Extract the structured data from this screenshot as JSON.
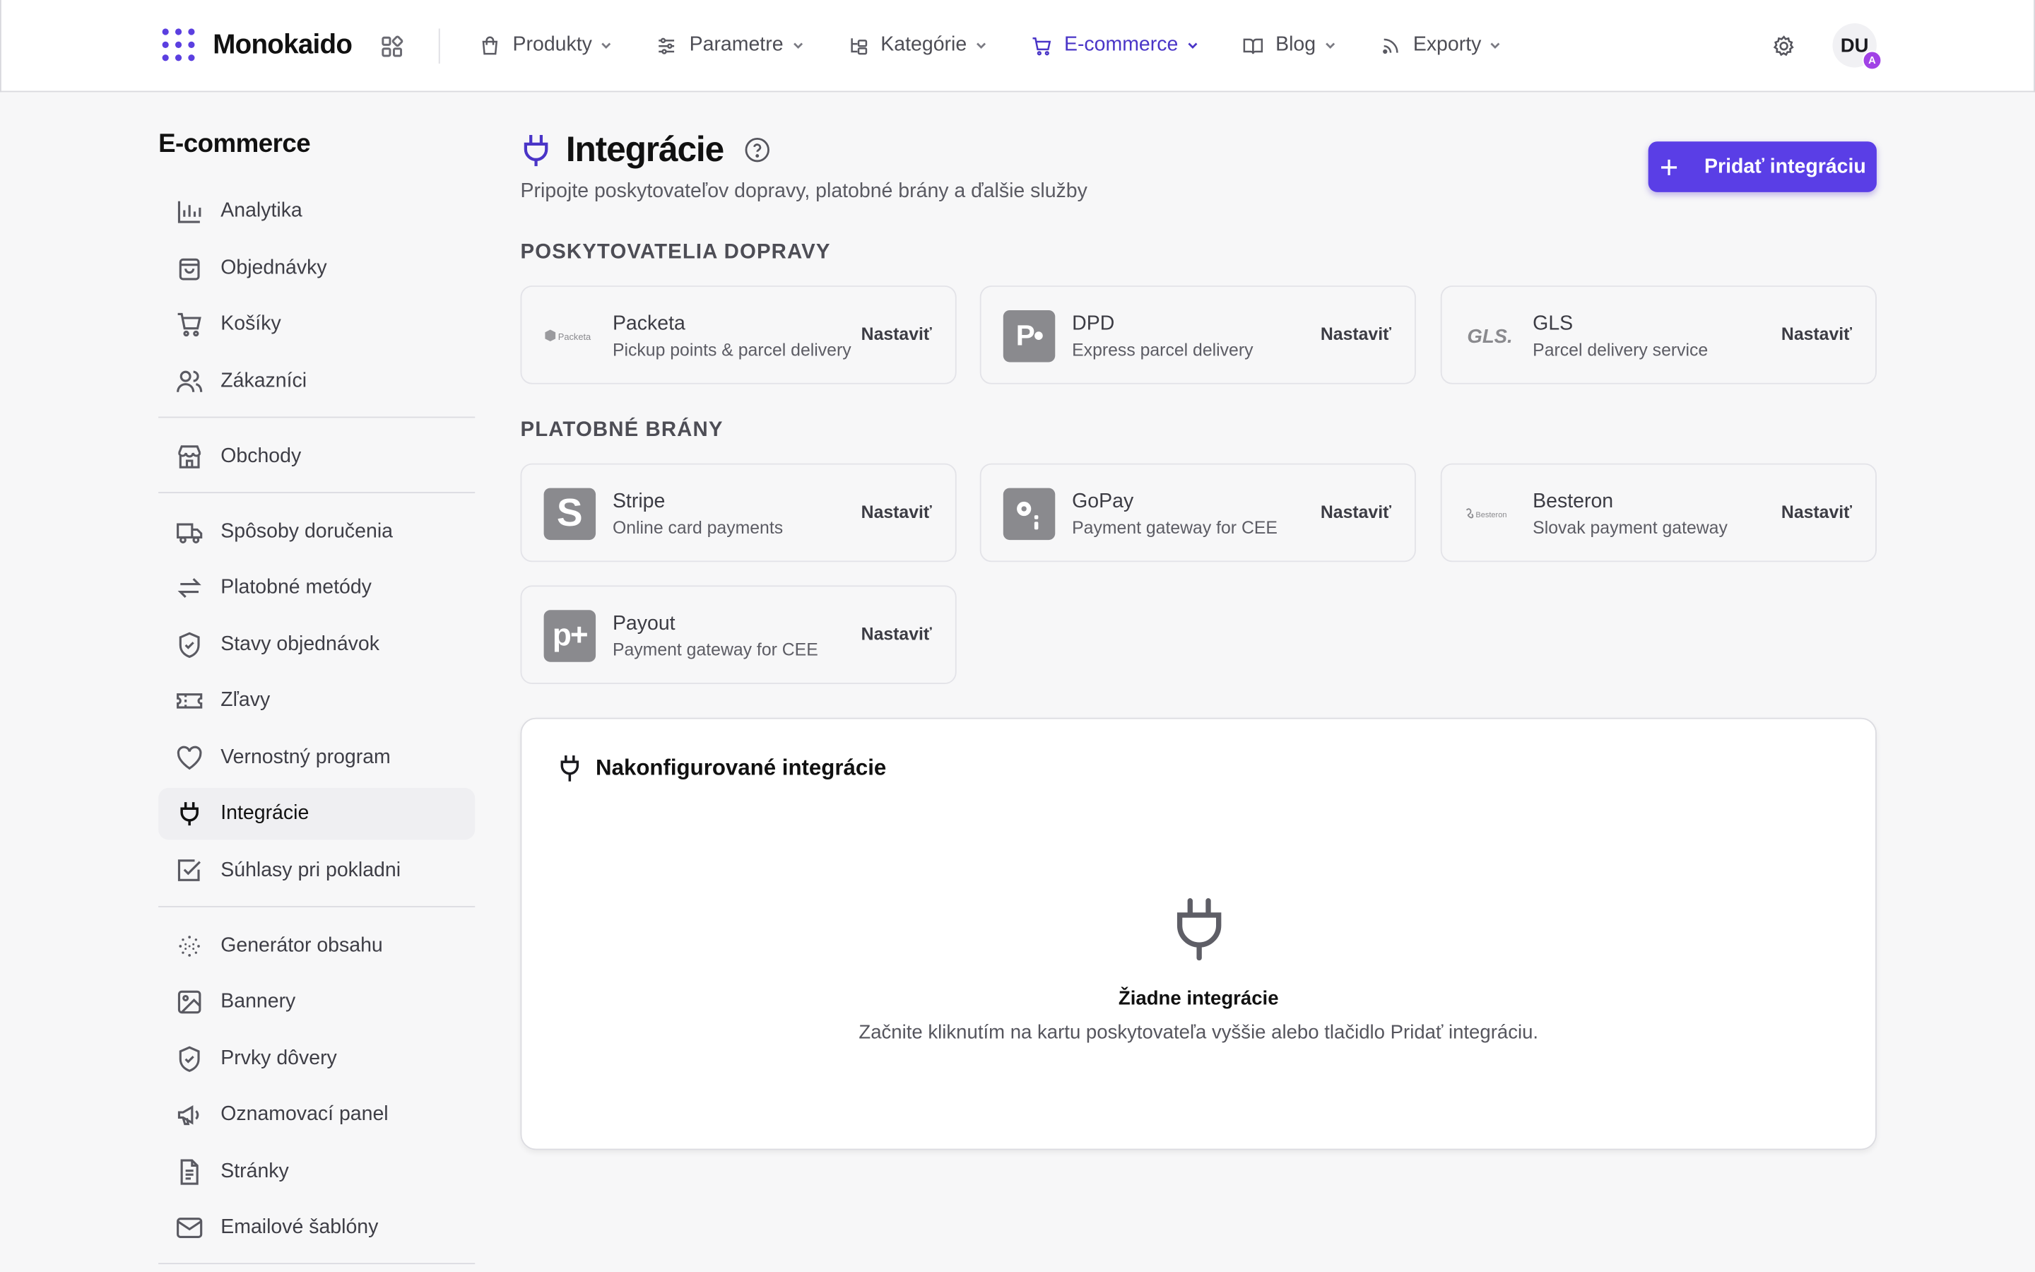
{
  "brand": {
    "name": "Monokaido",
    "accent": "#5a3ee6"
  },
  "nav": [
    {
      "label": "Produkty",
      "icon": "shopping-bag-icon"
    },
    {
      "label": "Parametre",
      "icon": "sliders-icon"
    },
    {
      "label": "Kategórie",
      "icon": "category-tree-icon"
    },
    {
      "label": "E-commerce",
      "icon": "cart-icon",
      "active": true
    },
    {
      "label": "Blog",
      "icon": "book-open-icon"
    },
    {
      "label": "Exporty",
      "icon": "rss-icon"
    }
  ],
  "user": {
    "initials": "DU",
    "badge": "A"
  },
  "sidebar": {
    "title": "E-commerce",
    "items": [
      {
        "label": "Analytika",
        "icon": "bar-chart-icon"
      },
      {
        "label": "Objednávky",
        "icon": "shopping-bag-icon"
      },
      {
        "label": "Košíky",
        "icon": "cart-icon"
      },
      {
        "label": "Zákazníci",
        "icon": "users-icon"
      },
      {
        "label": "Obchody",
        "icon": "store-icon"
      },
      {
        "label": "Spôsoby doručenia",
        "icon": "truck-icon"
      },
      {
        "label": "Platobné metódy",
        "icon": "arrows-exchange-icon"
      },
      {
        "label": "Stavy objednávok",
        "icon": "shield-check-icon"
      },
      {
        "label": "Zľavy",
        "icon": "ticket-icon"
      },
      {
        "label": "Vernostný program",
        "icon": "heart-icon"
      },
      {
        "label": "Integrácie",
        "icon": "plug-icon",
        "active": true
      },
      {
        "label": "Súhlasy pri pokladni",
        "icon": "checkbox-icon"
      },
      {
        "label": "Generátor obsahu",
        "icon": "sparkle-grid-icon"
      },
      {
        "label": "Bannery",
        "icon": "image-icon"
      },
      {
        "label": "Prvky dôvery",
        "icon": "shield-check-icon"
      },
      {
        "label": "Oznamovací panel",
        "icon": "megaphone-icon"
      },
      {
        "label": "Stránky",
        "icon": "file-text-icon"
      },
      {
        "label": "Emailové šablóny",
        "icon": "mail-icon"
      }
    ]
  },
  "page": {
    "title": "Integrácie",
    "subtitle": "Pripojte poskytovateľov dopravy, platobné brány a ďalšie služby",
    "add_button": "Pridať integráciu"
  },
  "shipping": {
    "label": "Poskytovatelia dopravy",
    "cards": [
      {
        "name": "Packeta",
        "desc": "Pickup points & parcel delivery",
        "action": "Nastaviť",
        "logo_text": "Packeta"
      },
      {
        "name": "DPD",
        "desc": "Express parcel delivery",
        "action": "Nastaviť",
        "logo_text": "P•"
      },
      {
        "name": "GLS",
        "desc": "Parcel delivery service",
        "action": "Nastaviť",
        "logo_text": "GLS."
      }
    ]
  },
  "payments": {
    "label": "Platobné brány",
    "cards": [
      {
        "name": "Stripe",
        "desc": "Online card payments",
        "action": "Nastaviť",
        "logo_text": "S"
      },
      {
        "name": "GoPay",
        "desc": "Payment gateway for CEE",
        "action": "Nastaviť",
        "logo_text": ""
      },
      {
        "name": "Besteron",
        "desc": "Slovak payment gateway",
        "action": "Nastaviť",
        "logo_text": "Besteron"
      },
      {
        "name": "Payout",
        "desc": "Payment gateway for CEE",
        "action": "Nastaviť",
        "logo_text": "p+"
      }
    ]
  },
  "configured": {
    "title": "Nakonfigurované integrácie",
    "empty_title": "Žiadne integrácie",
    "empty_sub": "Začnite kliknutím na kartu poskytovateľa vyššie alebo tlačidlo Pridať integráciu."
  }
}
